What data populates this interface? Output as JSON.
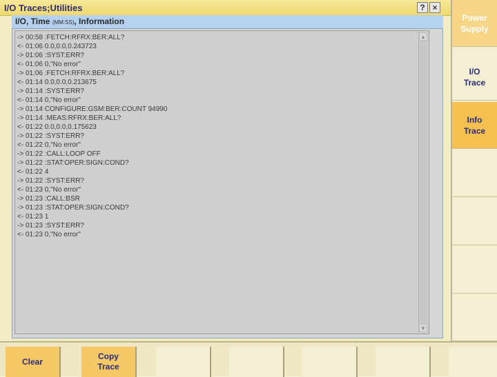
{
  "window": {
    "title": "I/O Traces;Utilities",
    "help_label": "?",
    "close_label": "×"
  },
  "panel": {
    "head_main": "I/O, Time",
    "head_unit": "(MM:SS)",
    "head_tail": ", Information"
  },
  "log": [
    "-> 00:58 :FETCH:RFRX:BER:ALL?",
    "<- 01:06 0.0,0.0,0.243723",
    "-> 01:06 :SYST:ERR?",
    "<- 01:06 0,\"No error\"",
    "-> 01:06 :FETCH:RFRX:BER:ALL?",
    "<- 01:14 0.0,0.0,0.213675",
    "-> 01:14 :SYST:ERR?",
    "<- 01:14 0,\"No error\"",
    "-> 01:14 CONFIGURE:GSM:BER:COUNT 94990",
    "-> 01:14 :MEAS:RFRX:BER:ALL?",
    "<- 01:22 0.0,0.0,0.175623",
    "-> 01:22 :SYST:ERR?",
    "<- 01:22 0,\"No error\"",
    "-> 01:22 :CALL:LOOP OFF",
    "-> 01:22 :STAT:OPER:SIGN:COND?",
    "<- 01:22 4",
    "-> 01:22 :SYST:ERR?",
    "<- 01:23 0,\"No error\"",
    "-> 01:23 :CALL:BSR",
    "-> 01:23 :STAT:OPER:SIGN:COND?",
    "<- 01:23 1",
    "-> 01:23 :SYST:ERR?",
    "<- 01:23 0,\"No error\""
  ],
  "scroll": {
    "up": "▲",
    "down": "▼"
  },
  "side_keys": [
    {
      "line1": "Power",
      "line2": "Supply",
      "state": "dim"
    },
    {
      "line1": "I/O",
      "line2": "Trace",
      "state": "norm"
    },
    {
      "line1": "Info",
      "line2": "Trace",
      "state": "active"
    }
  ],
  "bottom_keys": {
    "clear": "Clear",
    "copy_line1": "Copy",
    "copy_line2": "Trace"
  },
  "colors": {
    "accent": "#f5c04e",
    "title_text": "#2b2b7a",
    "panel_header": "#b6d1ef"
  }
}
